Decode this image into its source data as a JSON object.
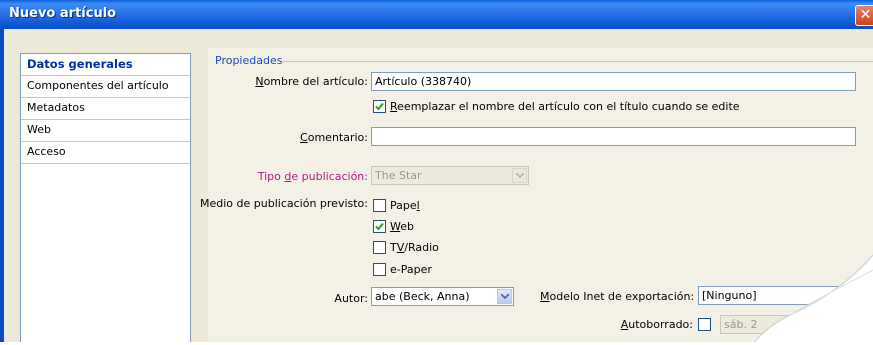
{
  "window": {
    "title": "Nuevo artículo"
  },
  "sidebar": {
    "items": [
      {
        "label": "Datos generales"
      },
      {
        "label": "Componentes del artículo"
      },
      {
        "label": "Metadatos"
      },
      {
        "label": "Web"
      },
      {
        "label": "Acceso"
      }
    ]
  },
  "form": {
    "group_title": "Propiedades",
    "name": {
      "label_pre": "",
      "label_key": "N",
      "label_post": "ombre del artículo:",
      "value": "Artículo (338740)"
    },
    "replace_checkbox": {
      "label_key": "R",
      "label_post": "eemplazar el nombre del artículo con el título cuando se edite",
      "checked": true
    },
    "comment": {
      "label_key": "C",
      "label_post": "omentario:",
      "value": ""
    },
    "pub_type": {
      "label_pre": "Tipo ",
      "label_key": "d",
      "label_post": "e publicación:",
      "value": "The Star"
    },
    "medium": {
      "label": "Medio de publicación previsto:",
      "options": [
        {
          "pre": "Pape",
          "key": "l",
          "post": "",
          "checked": false
        },
        {
          "pre": "",
          "key": "W",
          "post": "eb",
          "checked": true
        },
        {
          "pre": "T",
          "key": "V",
          "post": "/Radio",
          "checked": false
        },
        {
          "pre": "e-Paper",
          "key": "",
          "post": "",
          "checked": false
        }
      ]
    },
    "author": {
      "label": "Autor:",
      "value": "abe (Beck, Anna)"
    },
    "export_model": {
      "label_key": "M",
      "label_post": "odelo Inet de exportación:",
      "value": "[Ninguno]"
    },
    "autodelete": {
      "label_key": "A",
      "label_post": "utoborrado:",
      "checked": false,
      "date_value": "sáb. 2"
    }
  },
  "colors": {
    "title_bar": "#0a4cc0",
    "group_title": "#1a4bb5",
    "restricted_label": "#b0188c"
  }
}
